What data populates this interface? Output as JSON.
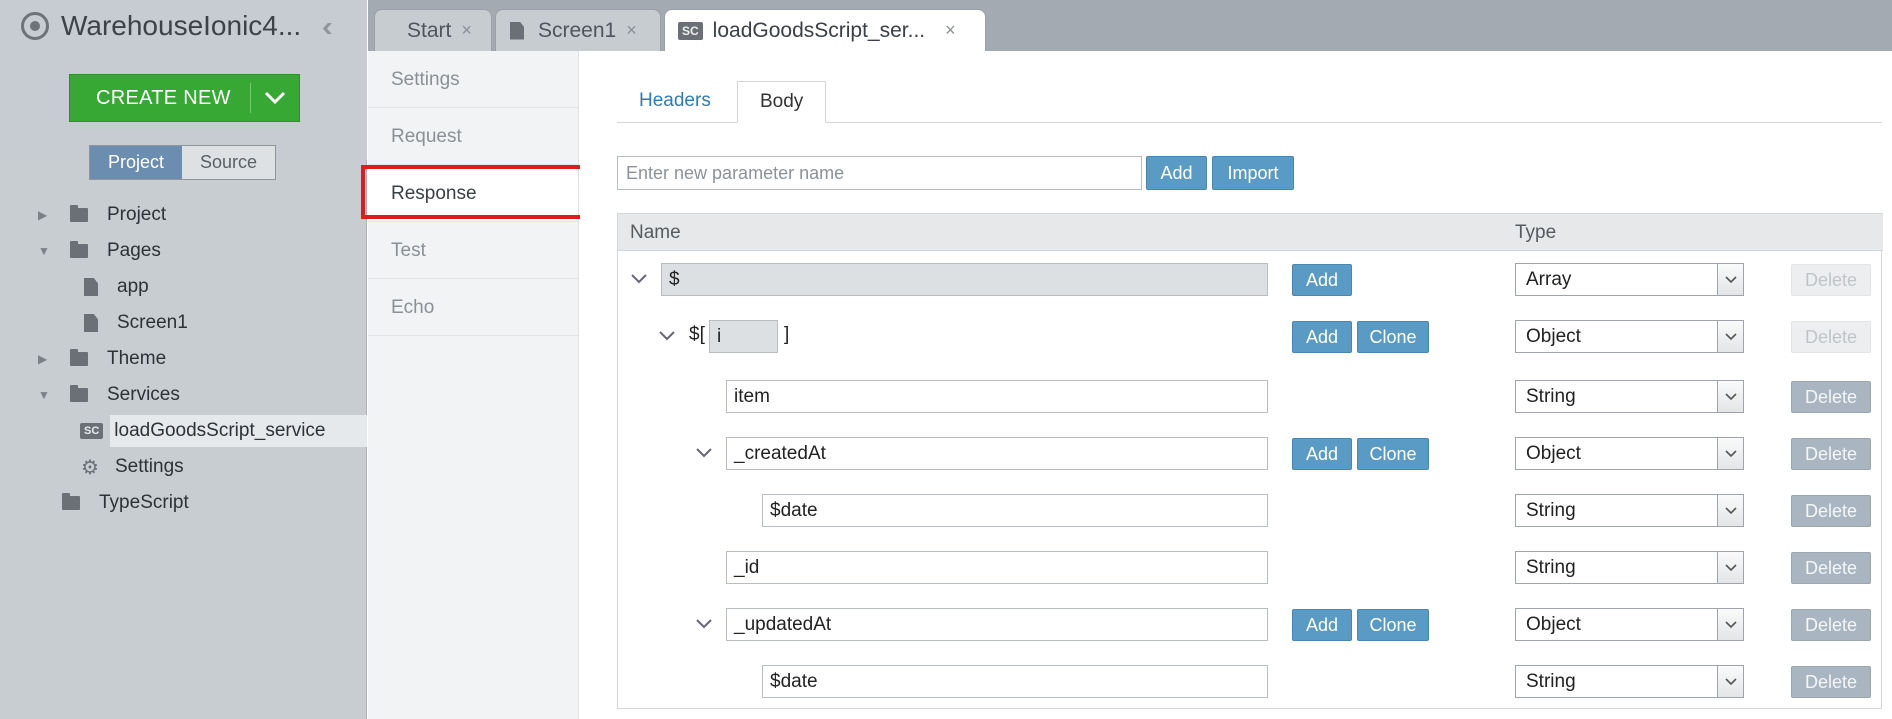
{
  "app": {
    "title": "WarehouseIonic4..."
  },
  "sidebar": {
    "create_label": "CREATE NEW",
    "segments": {
      "project": "Project",
      "source": "Source"
    },
    "tree": [
      {
        "label": "Project"
      },
      {
        "label": "Pages"
      },
      {
        "label": "app"
      },
      {
        "label": "Screen1"
      },
      {
        "label": "Theme"
      },
      {
        "label": "Services"
      },
      {
        "label": "loadGoodsScript_service"
      },
      {
        "label": "Settings"
      },
      {
        "label": "TypeScript"
      }
    ],
    "sc_badge": "SC"
  },
  "tabs": [
    {
      "label": "Start"
    },
    {
      "label": "Screen1"
    },
    {
      "label": "loadGoodsScript_ser..."
    }
  ],
  "tab_close": "×",
  "menu": [
    "Settings",
    "Request",
    "Response",
    "Test",
    "Echo"
  ],
  "subtabs": {
    "headers": "Headers",
    "body": "Body"
  },
  "param": {
    "placeholder": "Enter new parameter name",
    "add": "Add",
    "import": "Import"
  },
  "grid": {
    "col_name": "Name",
    "col_type": "Type",
    "add": "Add",
    "clone": "Clone",
    "delete": "Delete",
    "rows": [
      {
        "name": "$",
        "type": "Array"
      },
      {
        "prefix": "$[",
        "index": "i",
        "suffix": "]",
        "type": "Object"
      },
      {
        "name": "item",
        "type": "String"
      },
      {
        "name": "_createdAt",
        "type": "Object"
      },
      {
        "name": "$date",
        "type": "String"
      },
      {
        "name": "_id",
        "type": "String"
      },
      {
        "name": "_updatedAt",
        "type": "Object"
      },
      {
        "name": "$date",
        "type": "String"
      }
    ]
  },
  "colors": {
    "accent": "#5a9bc6",
    "create": "#37a834",
    "highlight": "#e01b1b"
  }
}
